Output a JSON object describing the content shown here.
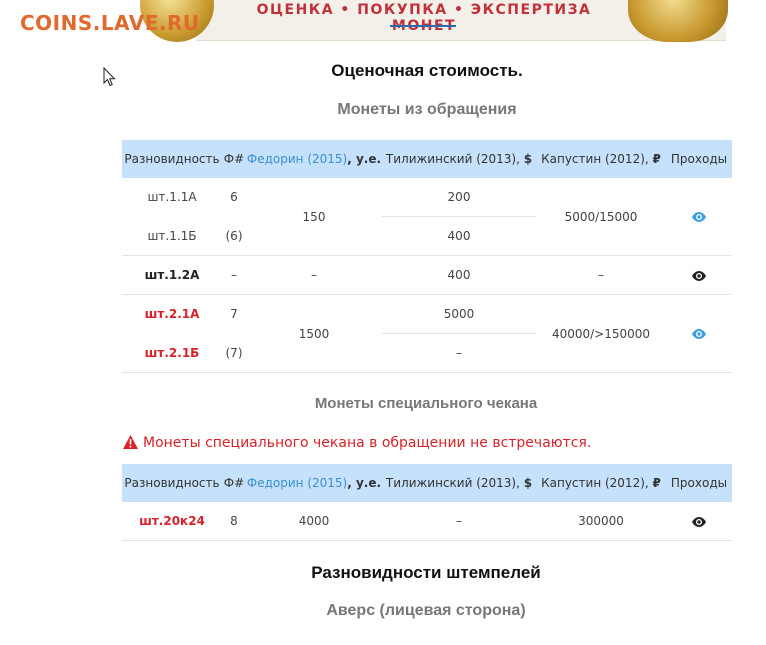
{
  "banner": {
    "site_logo": "COINS.LAVE.RU",
    "tagline": "ОЦЕНКА • ПОКУПКА • ЭКСПЕРТИЗА МОНЕТ"
  },
  "headings": {
    "valuation": "Оценочная стоимость.",
    "circulation": "Монеты из обращения",
    "special": "Монеты специального чекана",
    "stamp_varieties": "Разновидности штемпелей",
    "obverse": "Аверс (лицевая сторона)"
  },
  "warning": "Монеты специального чекана в обращении не встречаются.",
  "table_headers": {
    "variety": "Разновидность",
    "f_num": "Ф#",
    "fedorin": "Федорин (2015)",
    "fedorin_unit": ", у.е.",
    "tilizhinsky": "Тилижинский (2013), ",
    "tilizhinsky_unit": "$",
    "kapustin": "Капустин (2012), ",
    "kapustin_unit": "₽",
    "passes": "Проходы"
  },
  "circulation_rows": {
    "r1": {
      "variety": "шт.1.1А",
      "f": "6",
      "til": "200"
    },
    "r2": {
      "variety": "шт.1.1Б",
      "f": "(6)",
      "til": "400"
    },
    "g1_fedorin": "150",
    "g1_kapustin": "5000/15000",
    "r3": {
      "variety": "шт.1.2А",
      "f": "–",
      "fedorin": "–",
      "til": "400",
      "kapustin": "–"
    },
    "r4": {
      "variety": "шт.2.1А",
      "f": "7",
      "til": "5000"
    },
    "r5": {
      "variety": "шт.2.1Б",
      "f": "(7)",
      "til": "–"
    },
    "g3_fedorin": "1500",
    "g3_kapustin": "40000/>150000"
  },
  "special_rows": {
    "r1": {
      "variety": "шт.20к24",
      "f": "8",
      "fedorin": "4000",
      "til": "–",
      "kapustin": "300000"
    }
  },
  "colors": {
    "header_bg": "#c6e1fb",
    "link_blue": "#3a8fd0",
    "red": "#d8222a",
    "eye_blue": "#3a9ee0",
    "eye_dark": "#222222"
  },
  "icons": {
    "eye": "eye-icon",
    "warning": "warning-triangle-icon",
    "cursor": "mouse-pointer-icon"
  }
}
